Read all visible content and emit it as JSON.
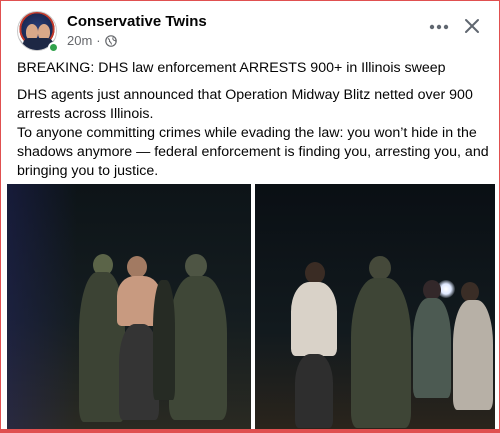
{
  "post": {
    "page_name": "Conservative Twins",
    "time": "20m",
    "separator": "·",
    "paragraphs": [
      "BREAKING: DHS law enforcement ARRESTS 900+ in Illinois sweep",
      "DHS agents just announced that Operation Midway Blitz netted over 900 arrests across Illinois.",
      "To anyone committing crimes while evading the law: you won’t hide in the shadows anymore — federal enforcement is finding you, arresting you, and bringing you to justice."
    ]
  },
  "icons": {
    "avatar": "avatar",
    "privacy": "globe-icon",
    "more": "more-horizontal-icon",
    "close": "close-icon"
  },
  "colors": {
    "accent_border": "#e05050",
    "meta_text": "#65676b",
    "online": "#31a24c"
  }
}
